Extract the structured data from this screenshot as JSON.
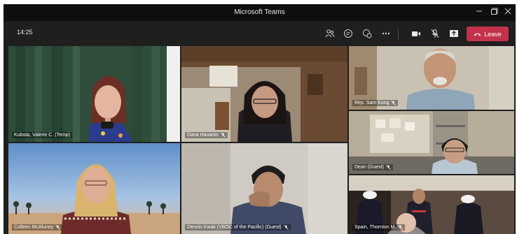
{
  "window": {
    "title": "Microsoft Teams"
  },
  "toolbar": {
    "timer": "14:25",
    "leave_label": "Leave",
    "icons": [
      "participants-icon",
      "chat-icon",
      "reactions-icon",
      "more-actions-icon",
      "camera-icon",
      "mic-off-icon",
      "share-screen-icon"
    ]
  },
  "colors": {
    "leave": "#c4314b",
    "background": "#1f1f1f",
    "titlebar": "#0f0f0f"
  },
  "participants": [
    {
      "name": "Kubota, Valerie C. (Temp)",
      "muted": false
    },
    {
      "name": "Dana Hauanio",
      "muted": true
    },
    {
      "name": "Rep. Sam Kong",
      "muted": true
    },
    {
      "name": "Dean (Guest)",
      "muted": true
    },
    {
      "name": "Colleen McAluney",
      "muted": true
    },
    {
      "name": "Dennis Kwak (VBOC of the Pacific) (Guest)",
      "muted": true
    },
    {
      "name": "Spain, Thornton M.",
      "muted": true
    }
  ]
}
